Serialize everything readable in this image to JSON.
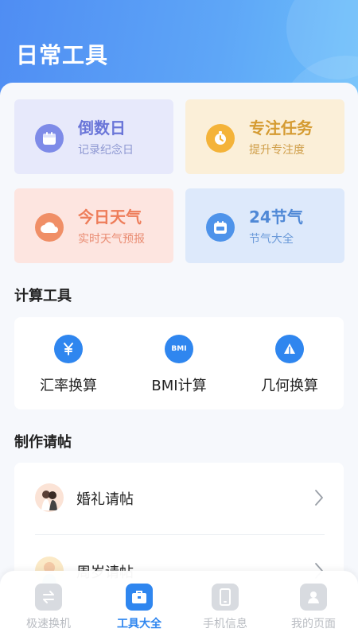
{
  "header": {
    "title": "日常工具"
  },
  "cards": [
    {
      "title": "倒数日",
      "subtitle": "记录纪念日",
      "icon": "calendar-icon"
    },
    {
      "title": "专注任务",
      "subtitle": "提升专注度",
      "icon": "timer-icon"
    },
    {
      "title": "今日天气",
      "subtitle": "实时天气预报",
      "icon": "cloud-icon"
    },
    {
      "title": "24节气",
      "subtitle": "节气大全",
      "icon": "solar-terms-calendar-icon"
    }
  ],
  "calc_section": {
    "title": "计算工具",
    "items": [
      {
        "label": "汇率换算",
        "icon": "yen-icon"
      },
      {
        "label": "BMI计算",
        "icon": "bmi-icon",
        "icon_text": "BMI"
      },
      {
        "label": "几何换算",
        "icon": "triangle-icon"
      }
    ]
  },
  "invite_section": {
    "title": "制作请帖",
    "items": [
      {
        "label": "婚礼请帖",
        "icon": "wedding-couple-avatar-icon"
      },
      {
        "label": "周岁请帖",
        "icon": "baby-avatar-icon"
      }
    ]
  },
  "tabbar": {
    "items": [
      {
        "label": "极速换机",
        "icon": "transfer-icon",
        "active": false
      },
      {
        "label": "工具大全",
        "icon": "toolbox-icon",
        "active": true
      },
      {
        "label": "手机信息",
        "icon": "phone-icon",
        "active": false
      },
      {
        "label": "我的页面",
        "icon": "user-icon",
        "active": false
      }
    ]
  },
  "colors": {
    "primary": "#2f86ef",
    "header_start": "#4f8df3",
    "header_end": "#6cc0fb"
  }
}
